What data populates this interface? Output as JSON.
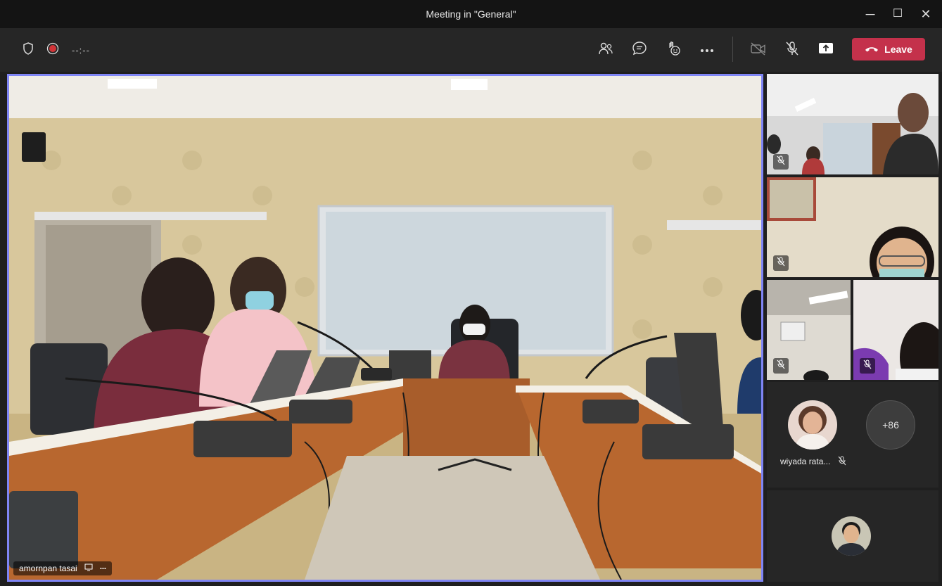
{
  "window": {
    "title": "Meeting in \"General\"",
    "minimize_glyph": "─",
    "maximize_glyph": "☐",
    "close_glyph": "✕"
  },
  "toolbar": {
    "timer": "--:--",
    "leave_label": "Leave",
    "icons": [
      "shield-icon",
      "record-icon",
      "people-icon",
      "chat-icon",
      "reactions-icon",
      "more-icon",
      "camera-off-icon",
      "mic-off-icon",
      "share-icon",
      "phone-icon"
    ]
  },
  "main_video": {
    "participant_name": "amornpan tasai",
    "more_glyph": "···"
  },
  "gallery": {
    "attendee_name": "wiyada rata...",
    "overflow_count": "+86"
  },
  "colors": {
    "leave_button": "#c4314b",
    "active_speaker_border": "#7f85f5",
    "toolbar_bg": "#262626",
    "titlebar_bg": "#141414"
  }
}
